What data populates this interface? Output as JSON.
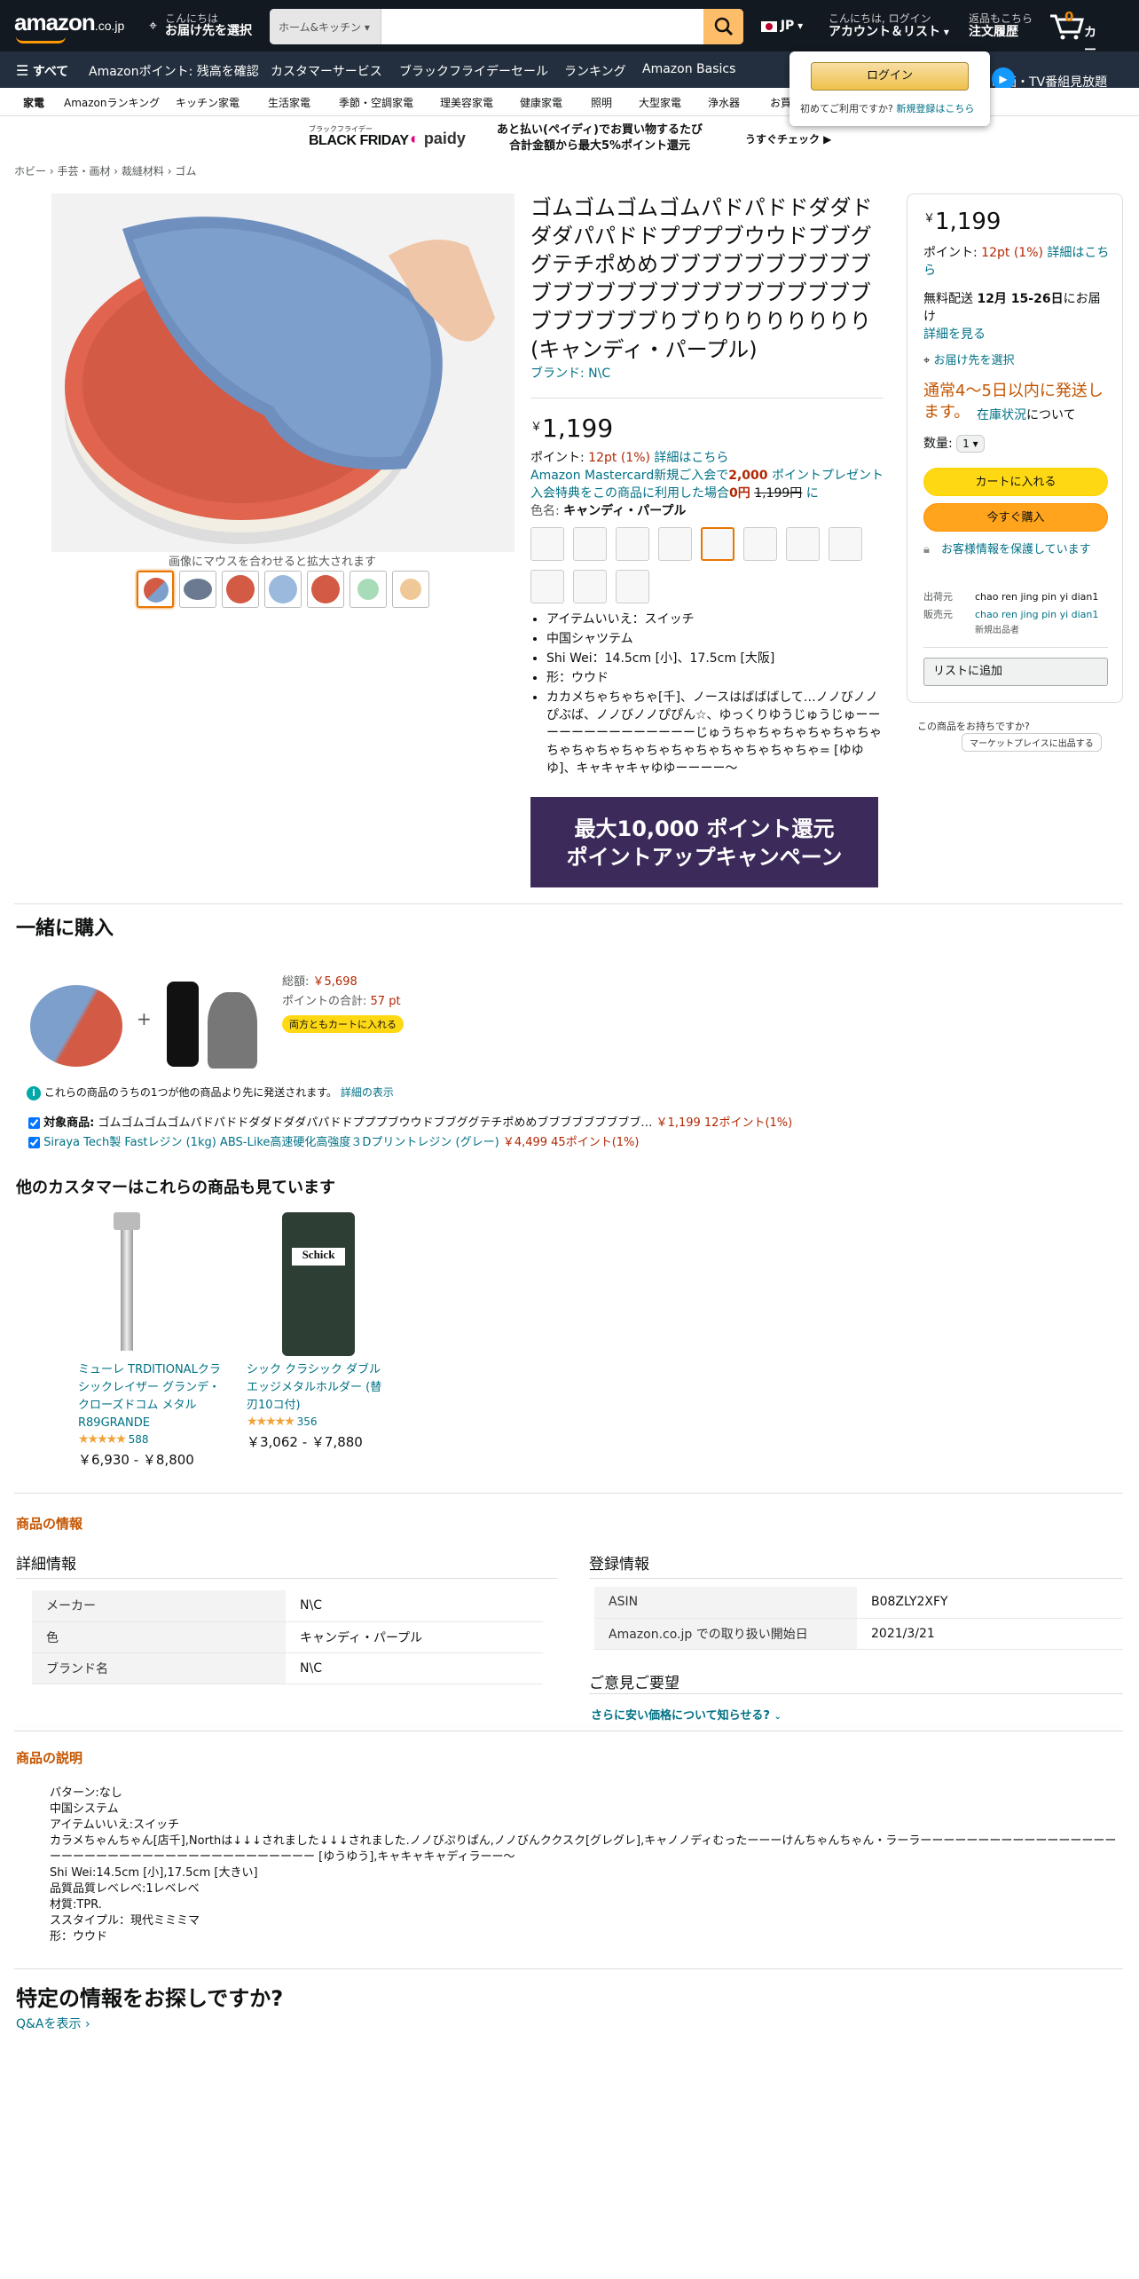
{
  "header": {
    "logo": "amazon",
    "logo_suffix": ".co.jp",
    "deliver_hello": "こんにちは",
    "deliver_cta": "お届け先を選択",
    "search_category": "ホーム&キッチン",
    "search_value": "",
    "lang": "JP",
    "account_hello": "こんにちは, ログイン",
    "account_label": "アカウント＆リスト",
    "returns_line1": "返品もこちら",
    "returns_line2": "注文履歴",
    "cart_count": "0",
    "cart_label": "カート"
  },
  "nav2": {
    "all": "すべて",
    "items": [
      "Amazonポイント: 残高を確認",
      "カスタマーサービス",
      "ブラックフライデーセール",
      "ランキング",
      "Amazon Basics"
    ],
    "right": "映画・TV番組見放題"
  },
  "nav3": {
    "items": [
      "家電",
      "Amazonランキング",
      "キッチン家電",
      "生活家電",
      "季節・空調家電",
      "理美容家電",
      "健康家電",
      "照明",
      "大型家電",
      "浄水器",
      "お買"
    ]
  },
  "login_popover": {
    "button": "ログイン",
    "first_time": "初めてご利用ですか?",
    "register": "新規登録はこちら"
  },
  "banner": {
    "bf_line1": "ブラックフライデー",
    "bf": "BLACK FRIDAY",
    "paidy": "paidy",
    "text1": "あと払い(ペイディ)でお買い物するたび",
    "text2": "合計金額から最大5%ポイント還元",
    "cta": "うすぐチェック ▶"
  },
  "breadcrumb": [
    "ホビー",
    "手芸・画材",
    "裁縫材料",
    "ゴム"
  ],
  "image_hint": "画像にマウスを合わせると拡大されます",
  "product": {
    "title": "ゴムゴムゴムゴムパドパドドダダドダダパパドドプププブウウドブブググテチポめめブブブブブブブブブブブブブブブブブブブブブブブブブブブブブブブブりブりりりりりりりり (キャンディ・パープル)",
    "brand": "ブランド: N\\C",
    "price_symbol": "￥",
    "price": "1,199",
    "points_label": "ポイント:",
    "points": "12pt",
    "points_pct": "(1%)",
    "points_link": "詳細はこちら",
    "mc_line1_a": "Amazon Mastercard新規ご入会で",
    "mc_points": "2,000",
    "mc_line1_b": " ポイントプレゼント",
    "mc_line2_a": "入会特典をこの商品に利用した場合",
    "mc_zero": "0円",
    "mc_strike": "1,199円",
    "mc_line2_b": " に",
    "color_label": "色名:",
    "color_value": "キャンディ・パープル",
    "bullets": [
      "アイテムいいえ：スイッチ",
      "中国シャツテム",
      "Shi Wei：14.5cm [小]、17.5cm [大阪]",
      "形：ウウド",
      "カカメちゃちゃちゃ[千]、ノースはばばばして…ノノびノノぴぶば、ノノびノノぴぴん☆、ゆっくりゆうじゅうじゅーーーーーーーーーーーーーーじゅうちゃちゃちゃちゃちゃちゃちゃちゃちゃちゃちゃちゃちゃちゃちゃちゃちゃ= [ゆゆゆ]、キャキャキャゆゆーーーー～"
    ],
    "promo_line1": "最大10,000 ポイント還元",
    "promo_line2": "ポイントアップキャンペーン"
  },
  "buybox": {
    "price_symbol": "￥",
    "price": "1,199",
    "points_label": "ポイント:",
    "points": "12pt",
    "points_pct": "(1%)",
    "points_link": "詳細はこちら",
    "free_ship": "無料配送",
    "ship_date": "12月 15-26日",
    "ship_suffix": "にお届け",
    "ship_detail": "詳細を見る",
    "deliver_to": "お届け先を選択",
    "avail": "通常4～5日以内に発送します。",
    "stock_link": "在庫状況",
    "stock_suffix": "について",
    "qty_label": "数量:",
    "qty": "1",
    "add_cart": "カートに入れる",
    "buy_now": "今すぐ購入",
    "secure": "お客様情報を保護しています",
    "shipper_label": "出荷元",
    "shipper": "chao ren jing pin yi dian1",
    "seller_label": "販売元",
    "seller": "chao ren jing pin yi dian1",
    "new_seller": "新規出品者",
    "add_list": "リストに追加",
    "have_one": "この商品をお持ちですか?",
    "sell_btn": "マーケットプレイスに出品する"
  },
  "together": {
    "heading": "一緒に購入",
    "total_label": "総額:",
    "total": "￥5,698",
    "points_label": "ポイントの合計:",
    "points": "57 pt",
    "both_btn": "両方ともカートに入れる",
    "notice": "これらの商品のうちの1つが他の商品より先に発送されます。",
    "notice_link": "詳細の表示",
    "item1_label": "対象商品:",
    "item1": "ゴムゴムゴムゴムパドパドドダダドダダパパドドプププブウウドブブググテチポめめブブブブブブブブブ…",
    "item1_price": "￥1,199 12ポイント(1%)",
    "item2": "Siraya Tech製 Fastレジン (1kg) ABS-Like高速硬化高強度３Dプリントレジン (グレー)",
    "item2_price": "￥4,499 45ポイント(1%)"
  },
  "also_viewed": {
    "heading": "他のカスタマーはこれらの商品も見ています",
    "items": [
      {
        "title": "ミューレ TRDITIONALクラシックレイザー グランデ・クローズドコム メタル R89GRANDE",
        "rating": "588",
        "price": "￥6,930 - ￥8,800",
        "stars": 4.5
      },
      {
        "title": "シック クラシック ダブルエッジメタルホルダー (替刃10コ付)",
        "rating": "356",
        "price": "￥3,062 - ￥7,880",
        "stars": 4.5
      }
    ]
  },
  "info": {
    "heading": "商品の情報",
    "detail_heading": "詳細情報",
    "detail": [
      [
        "メーカー",
        "N\\C"
      ],
      [
        "色",
        "キャンディ・パープル"
      ],
      [
        "ブランド名",
        "N\\C"
      ]
    ],
    "reg_heading": "登録情報",
    "reg": [
      [
        "ASIN",
        "B08ZLY2XFY"
      ],
      [
        "Amazon.co.jp での取り扱い開始日",
        "2021/3/21"
      ]
    ],
    "feedback_heading": "ご意見ご要望",
    "feedback_link": "さらに安い価格について知らせる?"
  },
  "description": {
    "heading": "商品の説明",
    "lines": [
      "パターン:なし",
      "中国システム",
      "アイテムいいえ:スイッチ",
      "カラメちゃんちゃん[店千],Northは↓↓↓されました↓↓↓されました.ノノびぷりぱん,ノノびんククスク[グレグレ],キャノノディむったーーーけんちゃんちゃん・ラーラーーーーーーーーーーーーーーーーーーーーーーーーーーーーーーーーーーーーーーーー [ゆうゆう],キャキャキャディラーー～",
      "Shi Wei:14.5cm [小],17.5cm [大きい]",
      "品質品質レベレベ:1レベレベ",
      "材質:TPR.",
      "ススタイプル：現代ミミミマ",
      "形：ウウド"
    ]
  },
  "qa": {
    "heading": "特定の情報をお探しですか?",
    "link": "Q&Aを表示 ›"
  }
}
